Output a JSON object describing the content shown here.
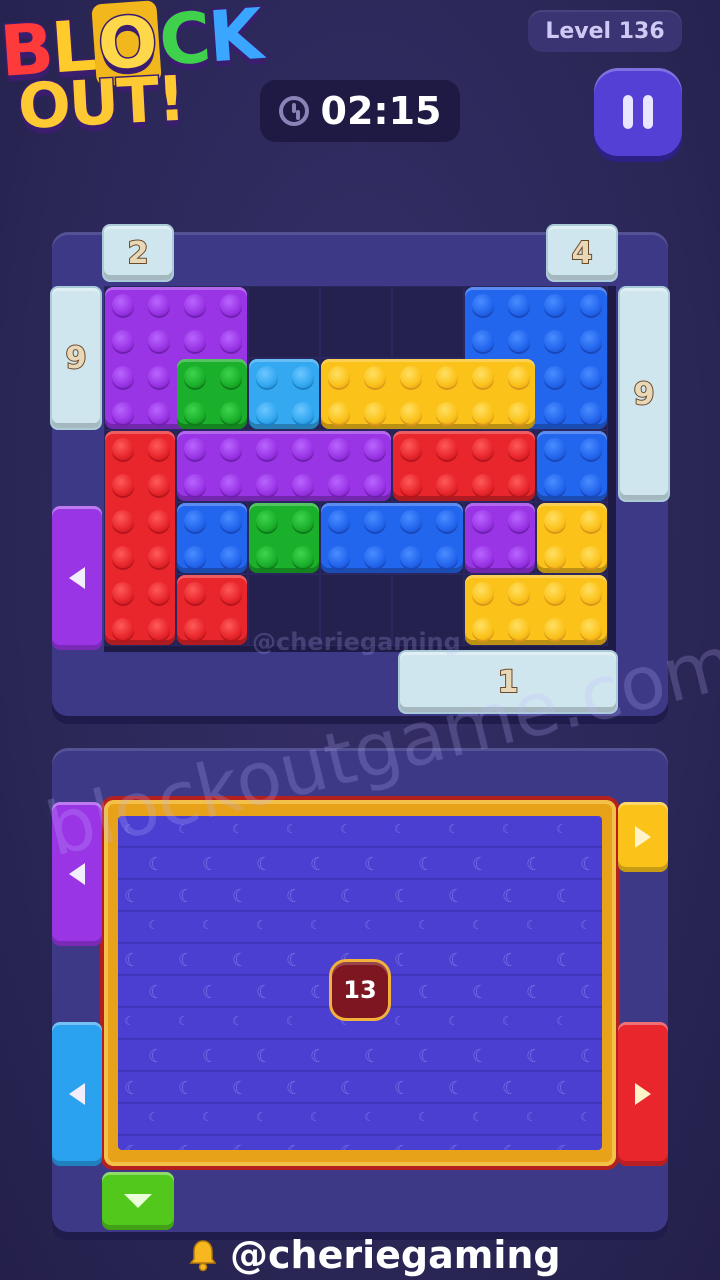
{
  "header": {
    "logo_top": "BLOCK",
    "logo_bottom": "OUT!",
    "level_label": "Level 136",
    "timer": "02:15"
  },
  "board": {
    "top_gates": [
      "2",
      "4"
    ],
    "side_gates": [
      "9",
      "9"
    ],
    "bottom_gate": "1"
  },
  "tray": {
    "remaining_count": "13"
  },
  "watermarks": {
    "site": "blockoutgame.com",
    "channel_small": "@cheriegaming"
  },
  "footer": {
    "handle": "@cheriegaming"
  },
  "colors": {
    "red": "#e8262c",
    "purple": "#9a35e6",
    "green": "#1bb02b",
    "cyan": "#34a8f0",
    "yellow": "#fbc21a",
    "blue": "#2366ee",
    "ice": "#cfe6ef"
  },
  "icons": [
    "clock-icon",
    "pause-icon",
    "bell-icon",
    "arrow-left-icon",
    "arrow-right-icon",
    "arrow-down-icon"
  ]
}
